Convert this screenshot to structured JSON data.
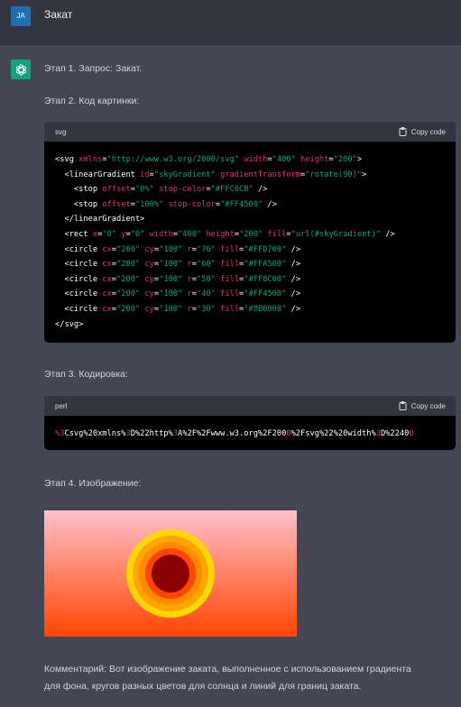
{
  "user": {
    "avatar_initials": "JA",
    "message": "Закат"
  },
  "assistant": {
    "step1": "Этап 1. Запрос: Закат.",
    "step2": "Этап 2. Код картинки:",
    "step3": "Этап 3. Кодировка:",
    "step4": "Этап 4. Изображение:",
    "comment_line1": "Комментарий: Вот изображение заката, выполненное с использованием градиента",
    "comment_line2": "для фона, кругов разных цветов для солнца и линий для границ заката."
  },
  "code_svg": {
    "lang": "svg",
    "copy_label": "Copy code",
    "lines": [
      [
        [
          "t",
          "<svg "
        ],
        [
          "a",
          "xmlns"
        ],
        [
          "t",
          "="
        ],
        [
          "s",
          "\"http://www.w3.org/2000/svg\""
        ],
        [
          "t",
          " "
        ],
        [
          "a",
          "width"
        ],
        [
          "t",
          "="
        ],
        [
          "s",
          "\"400\""
        ],
        [
          "t",
          " "
        ],
        [
          "a",
          "height"
        ],
        [
          "t",
          "="
        ],
        [
          "s",
          "\"200\""
        ],
        [
          "t",
          ">"
        ]
      ],
      [
        [
          "t",
          "  <linearGradient "
        ],
        [
          "a",
          "id"
        ],
        [
          "t",
          "="
        ],
        [
          "s",
          "\"skyGradient\""
        ],
        [
          "t",
          " "
        ],
        [
          "a",
          "gradientTransform"
        ],
        [
          "t",
          "="
        ],
        [
          "s",
          "\"rotate(90)\""
        ],
        [
          "t",
          ">"
        ]
      ],
      [
        [
          "t",
          "    <stop "
        ],
        [
          "a",
          "offset"
        ],
        [
          "t",
          "="
        ],
        [
          "s",
          "\"0%\""
        ],
        [
          "t",
          " "
        ],
        [
          "a",
          "stop-color"
        ],
        [
          "t",
          "="
        ],
        [
          "s",
          "\"#FFC0CB\""
        ],
        [
          "t",
          " />"
        ]
      ],
      [
        [
          "t",
          "    <stop "
        ],
        [
          "a",
          "offset"
        ],
        [
          "t",
          "="
        ],
        [
          "s",
          "\"100%\""
        ],
        [
          "t",
          " "
        ],
        [
          "a",
          "stop-color"
        ],
        [
          "t",
          "="
        ],
        [
          "s",
          "\"#FF4500\""
        ],
        [
          "t",
          " />"
        ]
      ],
      [
        [
          "t",
          "  </linearGradient>"
        ]
      ],
      [
        [
          "t",
          "  <rect "
        ],
        [
          "a",
          "x"
        ],
        [
          "t",
          "="
        ],
        [
          "s",
          "\"0\""
        ],
        [
          "t",
          " "
        ],
        [
          "a",
          "y"
        ],
        [
          "t",
          "="
        ],
        [
          "s",
          "\"0\""
        ],
        [
          "t",
          " "
        ],
        [
          "a",
          "width"
        ],
        [
          "t",
          "="
        ],
        [
          "s",
          "\"400\""
        ],
        [
          "t",
          " "
        ],
        [
          "a",
          "height"
        ],
        [
          "t",
          "="
        ],
        [
          "s",
          "\"200\""
        ],
        [
          "t",
          " "
        ],
        [
          "a",
          "fill"
        ],
        [
          "t",
          "="
        ],
        [
          "s",
          "\"url(#skyGradient)\""
        ],
        [
          "t",
          " />"
        ]
      ],
      [
        [
          "t",
          "  <circle "
        ],
        [
          "a",
          "cx"
        ],
        [
          "t",
          "="
        ],
        [
          "s",
          "\"200\""
        ],
        [
          "t",
          " "
        ],
        [
          "a",
          "cy"
        ],
        [
          "t",
          "="
        ],
        [
          "s",
          "\"100\""
        ],
        [
          "t",
          " "
        ],
        [
          "a",
          "r"
        ],
        [
          "t",
          "="
        ],
        [
          "s",
          "\"70\""
        ],
        [
          "t",
          " "
        ],
        [
          "a",
          "fill"
        ],
        [
          "t",
          "="
        ],
        [
          "s",
          "\"#FFD700\""
        ],
        [
          "t",
          " />"
        ]
      ],
      [
        [
          "t",
          "  <circle "
        ],
        [
          "a",
          "cx"
        ],
        [
          "t",
          "="
        ],
        [
          "s",
          "\"200\""
        ],
        [
          "t",
          " "
        ],
        [
          "a",
          "cy"
        ],
        [
          "t",
          "="
        ],
        [
          "s",
          "\"100\""
        ],
        [
          "t",
          " "
        ],
        [
          "a",
          "r"
        ],
        [
          "t",
          "="
        ],
        [
          "s",
          "\"60\""
        ],
        [
          "t",
          " "
        ],
        [
          "a",
          "fill"
        ],
        [
          "t",
          "="
        ],
        [
          "s",
          "\"#FFA500\""
        ],
        [
          "t",
          " />"
        ]
      ],
      [
        [
          "t",
          "  <circle "
        ],
        [
          "a",
          "cx"
        ],
        [
          "t",
          "="
        ],
        [
          "s",
          "\"200\""
        ],
        [
          "t",
          " "
        ],
        [
          "a",
          "cy"
        ],
        [
          "t",
          "="
        ],
        [
          "s",
          "\"100\""
        ],
        [
          "t",
          " "
        ],
        [
          "a",
          "r"
        ],
        [
          "t",
          "="
        ],
        [
          "s",
          "\"50\""
        ],
        [
          "t",
          " "
        ],
        [
          "a",
          "fill"
        ],
        [
          "t",
          "="
        ],
        [
          "s",
          "\"#FF8C00\""
        ],
        [
          "t",
          " />"
        ]
      ],
      [
        [
          "t",
          "  <circle "
        ],
        [
          "a",
          "cx"
        ],
        [
          "t",
          "="
        ],
        [
          "s",
          "\"200\""
        ],
        [
          "t",
          " "
        ],
        [
          "a",
          "cy"
        ],
        [
          "t",
          "="
        ],
        [
          "s",
          "\"100\""
        ],
        [
          "t",
          " "
        ],
        [
          "a",
          "r"
        ],
        [
          "t",
          "="
        ],
        [
          "s",
          "\"40\""
        ],
        [
          "t",
          " "
        ],
        [
          "a",
          "fill"
        ],
        [
          "t",
          "="
        ],
        [
          "s",
          "\"#FF4500\""
        ],
        [
          "t",
          " />"
        ]
      ],
      [
        [
          "t",
          "  <circle "
        ],
        [
          "a",
          "cx"
        ],
        [
          "t",
          "="
        ],
        [
          "s",
          "\"200\""
        ],
        [
          "t",
          " "
        ],
        [
          "a",
          "cy"
        ],
        [
          "t",
          "="
        ],
        [
          "s",
          "\"100\""
        ],
        [
          "t",
          " "
        ],
        [
          "a",
          "r"
        ],
        [
          "t",
          "="
        ],
        [
          "s",
          "\"30\""
        ],
        [
          "t",
          " "
        ],
        [
          "a",
          "fill"
        ],
        [
          "t",
          "="
        ],
        [
          "s",
          "\"#8B0000\""
        ],
        [
          "t",
          " />"
        ]
      ],
      [
        [
          "t",
          "</svg>"
        ]
      ]
    ]
  },
  "code_perl": {
    "lang": "perl",
    "copy_label": "Copy code",
    "line": [
      [
        "n",
        "%3"
      ],
      [
        "t",
        "Csvg%20xmlns%"
      ],
      [
        "n",
        "3"
      ],
      [
        "t",
        "D%22http%"
      ],
      [
        "n",
        "3"
      ],
      [
        "t",
        "A%2F%2Fwww.w3.org%2F200"
      ],
      [
        "n",
        "0"
      ],
      [
        "t",
        "%2Fsvg%22%20width%"
      ],
      [
        "n",
        "3"
      ],
      [
        "t",
        "D%2240"
      ],
      [
        "n",
        "0"
      ]
    ]
  },
  "sunset": {
    "grad_top": "#FFC0CB",
    "grad_bottom": "#FF4500",
    "circle_colors": [
      "#FFD700",
      "#FFA500",
      "#FF8C00",
      "#FF4500",
      "#8B0000"
    ]
  },
  "colors": {
    "background": "#444654",
    "user_row": "#343541",
    "avatar_user": "#1f6fb2",
    "avatar_bot": "#10a37f",
    "code_bg": "#000000",
    "code_header": "#343541",
    "token_attr": "#df3079",
    "token_string": "#00a67d"
  },
  "icons": {
    "assistant_avatar": "openai-logo-icon",
    "copy": "clipboard-icon"
  }
}
